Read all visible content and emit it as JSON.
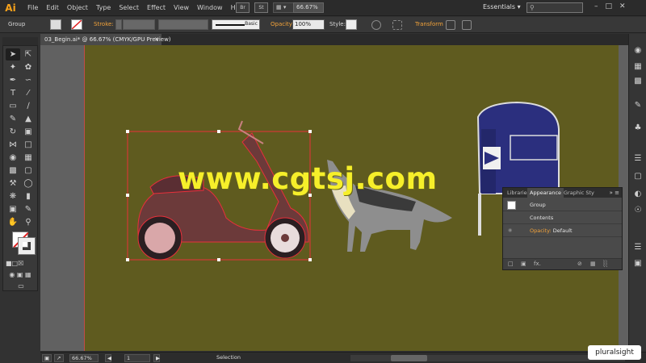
{
  "app": {
    "logo": "Ai"
  },
  "menubar": {
    "items": [
      "File",
      "Edit",
      "Object",
      "Type",
      "Select",
      "Effect",
      "View",
      "Window",
      "Help"
    ],
    "br_label": "Br",
    "st_label": "St",
    "zoom": "66.67%",
    "workspace": "Essentials ▾",
    "window_controls": [
      "–",
      "□",
      "✕"
    ]
  },
  "controlbar": {
    "selection_type": "Group",
    "stroke_label": "Stroke:",
    "stroke_style": "Basic",
    "opacity_label": "Opacity:",
    "opacity_value": "100%",
    "style_label": "Style:",
    "transform_label": "Transform"
  },
  "document": {
    "tab_title": "03_Begin.ai* @ 66.67% (CMYK/GPU Preview)",
    "close": "✕"
  },
  "watermark": "www.cgtsj.com",
  "panel": {
    "tabs": [
      "Libraries",
      "Appearance",
      "Graphic Sty"
    ],
    "menu_glyphs": "» ≡",
    "rows": {
      "group": "Group",
      "contents": "Contents",
      "opacity_label": "Opacity:",
      "opacity_value": "Default"
    },
    "footer_fx": "fx."
  },
  "statusbar": {
    "zoom": "66.67%",
    "page": "1",
    "tool": "Selection"
  },
  "branding": "pluralsight",
  "colors": {
    "accent": "#f3a33a",
    "artboard": "#5f5b1f",
    "selection": "#e8303a",
    "watermark": "#f6ef2a",
    "mailbox": "#2b2f7e"
  }
}
